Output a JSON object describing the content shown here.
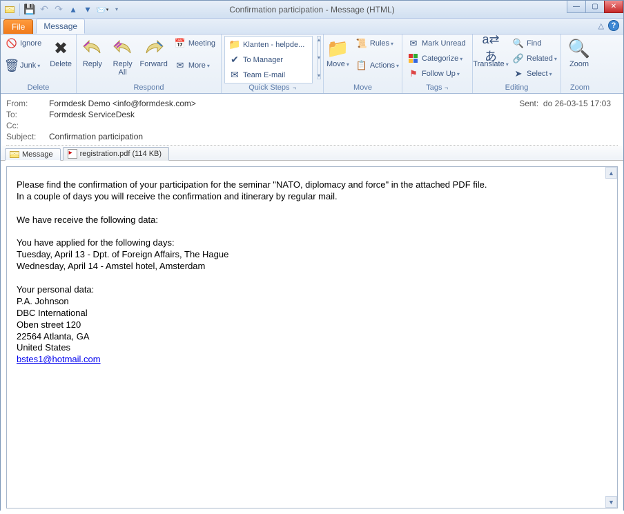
{
  "window": {
    "title": "Confirmation participation - Message (HTML)"
  },
  "tabs": {
    "file": "File",
    "message": "Message"
  },
  "ribbon": {
    "delete": {
      "ignore": "Ignore",
      "junk": "Junk",
      "delete": "Delete",
      "group": "Delete"
    },
    "respond": {
      "reply": "Reply",
      "replyall": "Reply\nAll",
      "forward": "Forward",
      "meeting": "Meeting",
      "more": "More",
      "group": "Respond"
    },
    "quicksteps": {
      "a": "Klanten - helpde...",
      "b": "To Manager",
      "c": "Team E-mail",
      "group": "Quick Steps"
    },
    "move": {
      "move": "Move",
      "rules": "Rules",
      "actions": "Actions",
      "group": "Move"
    },
    "tags": {
      "unread": "Mark Unread",
      "categorize": "Categorize",
      "followup": "Follow Up",
      "group": "Tags"
    },
    "editing": {
      "translate": "Translate",
      "find": "Find",
      "related": "Related",
      "select": "Select",
      "group": "Editing"
    },
    "zoom": {
      "zoom": "Zoom",
      "group": "Zoom"
    }
  },
  "headers": {
    "from_label": "From:",
    "from": "Formdesk Demo <info@formdesk.com>",
    "to_label": "To:",
    "to": "Formdesk ServiceDesk",
    "cc_label": "Cc:",
    "cc": "",
    "subject_label": "Subject:",
    "subject": "Confirmation participation",
    "sent_label": "Sent:",
    "sent": "do 26-03-15 17:03"
  },
  "attachments": {
    "tab_message": "Message",
    "tab_pdf": "registration.pdf (114 KB)"
  },
  "body": {
    "l1": "Please find the confirmation of your participation for the seminar \"NATO, diplomacy and force\" in the attached PDF file.",
    "l2": "In a couple of days you will receive the confirmation and itinerary by regular mail.",
    "l3": "We have receive the following data:",
    "l4": "You have applied for the following days:",
    "l5": "Tuesday, April 13 - Dpt. of Foreign Affairs, The Hague",
    "l6": "Wednesday, April 14 - Amstel hotel, Amsterdam",
    "l7": "Your personal data:",
    "l8": "P.A. Johnson",
    "l9": "DBC International",
    "l10": "Oben street 120",
    "l11": "22564 Atlanta, GA",
    "l12": "United States",
    "l13": "bstes1@hotmail.com"
  }
}
